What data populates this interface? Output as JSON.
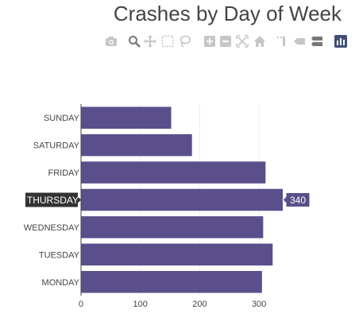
{
  "chart_data": {
    "type": "bar",
    "orientation": "horizontal",
    "title": "Crashes by Day of Week",
    "xlabel": "",
    "ylabel": "",
    "categories": [
      "MONDAY",
      "TUESDAY",
      "WEDNESDAY",
      "THURSDAY",
      "FRIDAY",
      "SATURDAY",
      "SUNDAY"
    ],
    "values": [
      305,
      323,
      307,
      340,
      311,
      187,
      152
    ],
    "xlim": [
      0,
      340
    ],
    "xticks": [
      0,
      100,
      200,
      300
    ],
    "grid": true,
    "bar_color": "#5a4f8b",
    "hover": {
      "category": "THURSDAY",
      "value_label": "340",
      "label_bg": "#333333"
    }
  },
  "modebar": {
    "icons": [
      "camera-icon",
      "zoom-icon",
      "pan-icon",
      "box-select-icon",
      "lasso-icon",
      "zoom-in-icon",
      "zoom-out-icon",
      "autoscale-icon",
      "reset-axes-icon",
      "spike-lines-icon",
      "hover-closest-icon",
      "hover-compare-icon",
      "plotly-logo-icon"
    ]
  }
}
